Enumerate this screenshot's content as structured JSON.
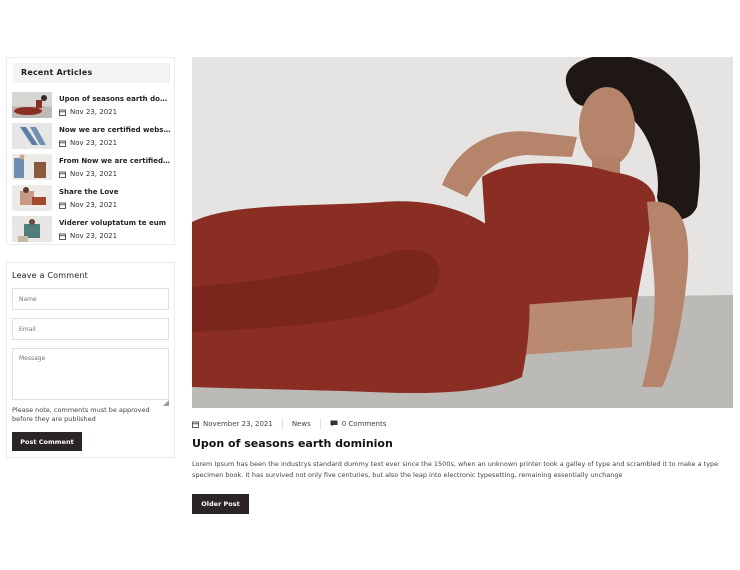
{
  "sidebar": {
    "recent_title": "Recent Articles",
    "articles": [
      {
        "title": "Upon of seasons earth domini...",
        "date": "Nov 23, 2021"
      },
      {
        "title": "Now we are certified websites",
        "date": "Nov 23, 2021"
      },
      {
        "title": "From Now we are certified web",
        "date": "Nov 23, 2021"
      },
      {
        "title": "Share the Love",
        "date": "Nov 23, 2021"
      },
      {
        "title": "Viderer voluptatum te eum",
        "date": "Nov 23, 2021"
      }
    ],
    "comment": {
      "title": "Leave a Comment",
      "name_placeholder": "Name",
      "email_placeholder": "Email",
      "message_placeholder": "Message",
      "note": "Please note, comments must be approved before they are published",
      "submit_label": "Post Comment"
    }
  },
  "post": {
    "date": "November 23, 2021",
    "category": "News",
    "comments": "0 Comments",
    "title": "Upon of seasons earth dominion",
    "body": "Lorem Ipsum has been the industrys standard dummy text ever since the 1500s, when an unknown printer took a galley of type and scrambled it to make a type specimen book. It has survived not only five centuries, but also the leap into electronic typesetting, remaining essentially unchange",
    "older_label": "Older Post"
  },
  "colors": {
    "accent_dark": "#2b2625",
    "garment": "#8a2e24",
    "background_wall": "#e4e3e1",
    "floor": "#b9b7b3"
  },
  "icons": [
    "calendar-icon",
    "comment-icon",
    "resize-handle-icon"
  ]
}
